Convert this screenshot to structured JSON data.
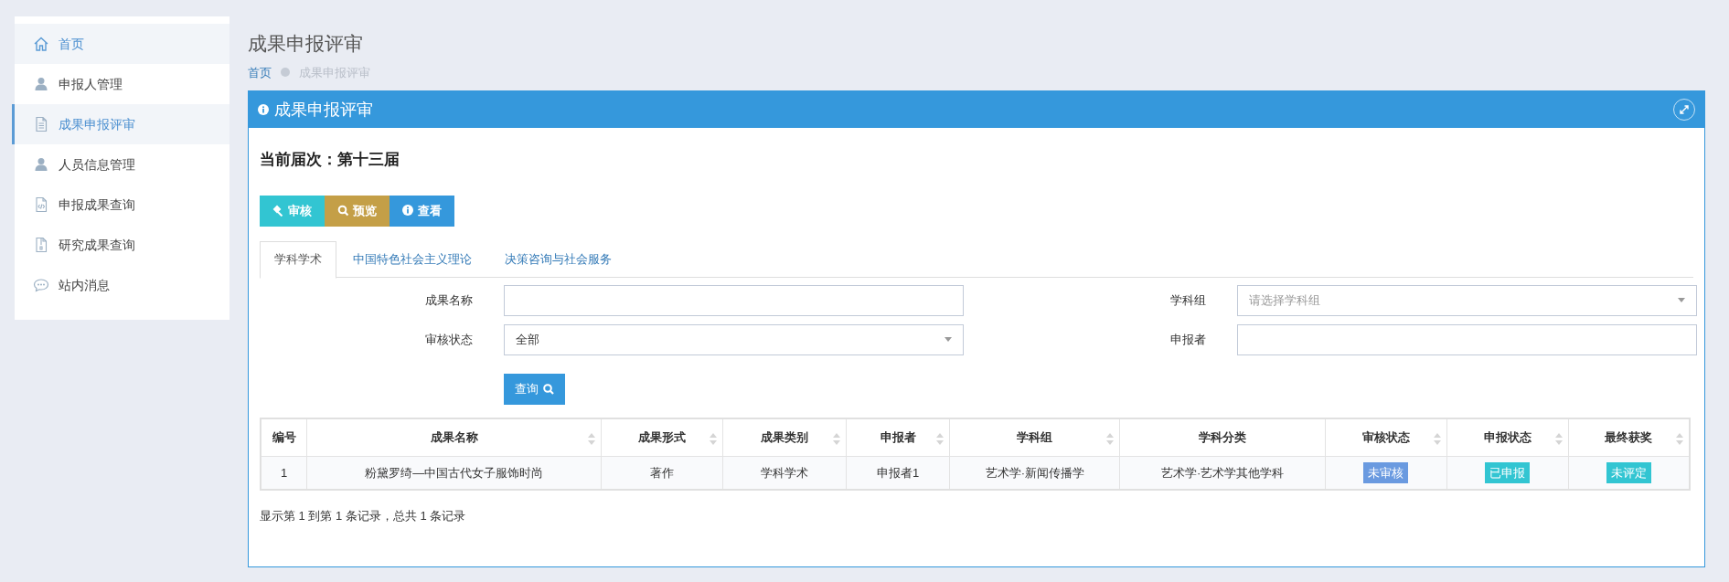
{
  "sidebar": {
    "items": [
      {
        "label": "首页",
        "selected": false,
        "highlighted": true
      },
      {
        "label": "申报人管理",
        "selected": false,
        "highlighted": false
      },
      {
        "label": "成果申报评审",
        "selected": true,
        "highlighted": true
      },
      {
        "label": "人员信息管理",
        "selected": false,
        "highlighted": false
      },
      {
        "label": "申报成果查询",
        "selected": false,
        "highlighted": false
      },
      {
        "label": "研究成果查询",
        "selected": false,
        "highlighted": false
      },
      {
        "label": "站内消息",
        "selected": false,
        "highlighted": false
      }
    ]
  },
  "page_title": "成果申报评审",
  "breadcrumb": [
    "首页",
    "成果申报评审"
  ],
  "panel": {
    "title": "成果申报评审",
    "session": "当前届次：第十三届",
    "actions": [
      {
        "label": "审核",
        "kind": "review"
      },
      {
        "label": "预览",
        "kind": "preview"
      },
      {
        "label": "查看",
        "kind": "view"
      }
    ],
    "tabs": [
      {
        "label": "学科学术",
        "selected": true
      },
      {
        "label": "中国特色社会主义理论",
        "selected": false
      },
      {
        "label": "决策咨询与社会服务",
        "selected": false
      }
    ],
    "filters": [
      {
        "label": "成果名称",
        "kind": "text"
      },
      {
        "label": "学科组",
        "kind": "select",
        "placeholder": "请选择学科组"
      },
      {
        "label": "审核状态",
        "kind": "select",
        "value": "全部"
      },
      {
        "label": "申报者",
        "kind": "text"
      }
    ],
    "query_button": "查询",
    "table": {
      "columns": [
        {
          "label": "编号",
          "sortable": false
        },
        {
          "label": "成果名称",
          "sortable": true
        },
        {
          "label": "成果形式",
          "sortable": true
        },
        {
          "label": "成果类别",
          "sortable": true
        },
        {
          "label": "申报者",
          "sortable": true
        },
        {
          "label": "学科组",
          "sortable": true
        },
        {
          "label": "学科分类",
          "sortable": false
        },
        {
          "label": "审核状态",
          "sortable": true
        },
        {
          "label": "申报状态",
          "sortable": true
        },
        {
          "label": "最终获奖",
          "sortable": true
        }
      ],
      "rows": [
        {
          "cells": [
            "1",
            "粉黛罗绮—中国古代女子服饰时尚",
            "著作",
            "学科学术",
            "申报者1",
            "艺术学·新闻传播学",
            "艺术学·艺术学其他学科"
          ],
          "badges": [
            {
              "text": "未审核",
              "color": "#6a9ae0"
            },
            {
              "text": "已申报",
              "color": "#32c5d2"
            },
            {
              "text": "未评定",
              "color": "#32c5d2"
            }
          ]
        }
      ]
    },
    "summary": "显示第 1 到第 1 条记录，总共 1 条记录"
  }
}
